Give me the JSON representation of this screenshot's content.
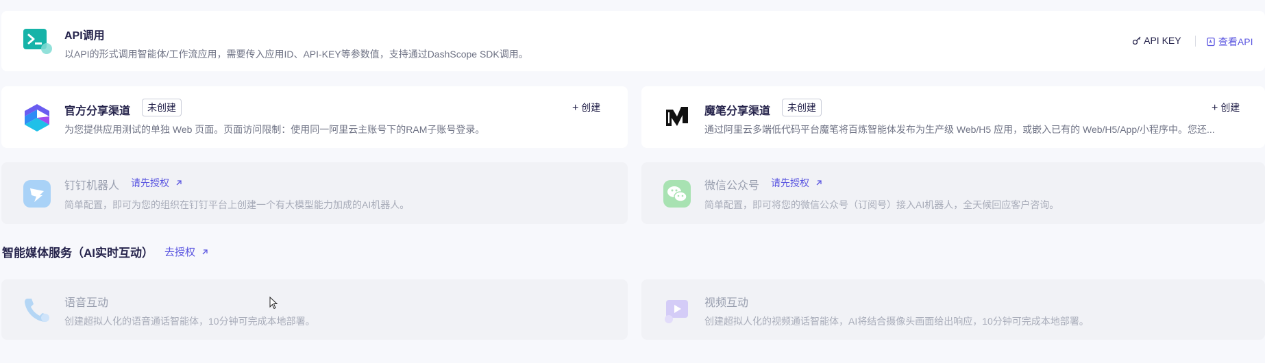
{
  "api": {
    "title": "API调用",
    "desc": "以API的形式调用智能体/工作流应用，需要传入应用ID、API-KEY等参数值，支持通过DashScope SDK调用。",
    "api_key_label": "API KEY",
    "view_api_label": "查看API",
    "icon": "terminal-icon"
  },
  "official_channel": {
    "title": "官方分享渠道",
    "badge": "未创建",
    "create_label": "创建",
    "desc": "为您提供应用测试的单独 Web 页面。页面访问限制：使用同一阿里云主账号下的RAM子账号登录。",
    "icon": "official-logo-icon"
  },
  "mobi_channel": {
    "title": "魔笔分享渠道",
    "badge": "未创建",
    "create_label": "创建",
    "desc": "通过阿里云多端低代码平台魔笔将百炼智能体发布为生产级 Web/H5 应用，或嵌入已有的 Web/H5/App/小程序中。您还...",
    "icon": "mobi-logo-icon"
  },
  "dingtalk": {
    "title": "钉钉机器人",
    "auth_label": "请先授权",
    "desc": "简单配置，即可为您的组织在钉钉平台上创建一个有大模型能力加成的AI机器人。",
    "icon": "dingtalk-icon"
  },
  "wechat": {
    "title": "微信公众号",
    "auth_label": "请先授权",
    "desc": "简单配置，即可将您的微信公众号（订阅号）接入AI机器人，全天候回应客户咨询。",
    "icon": "wechat-icon"
  },
  "media_section": {
    "title": "智能媒体服务（AI实时互动）",
    "auth_label": "去授权"
  },
  "voice": {
    "title": "语音互动",
    "desc": "创建超拟人化的语音通话智能体，10分钟可完成本地部署。",
    "icon": "phone-icon"
  },
  "video": {
    "title": "视频互动",
    "desc": "创建超拟人化的视频通话智能体，AI将结合摄像头画面给出响应，10分钟可完成本地部署。",
    "icon": "video-icon"
  },
  "colors": {
    "accent": "#5a55e0",
    "page_bg": "#f7f8fc",
    "api_icon": "#1bb8b0"
  }
}
